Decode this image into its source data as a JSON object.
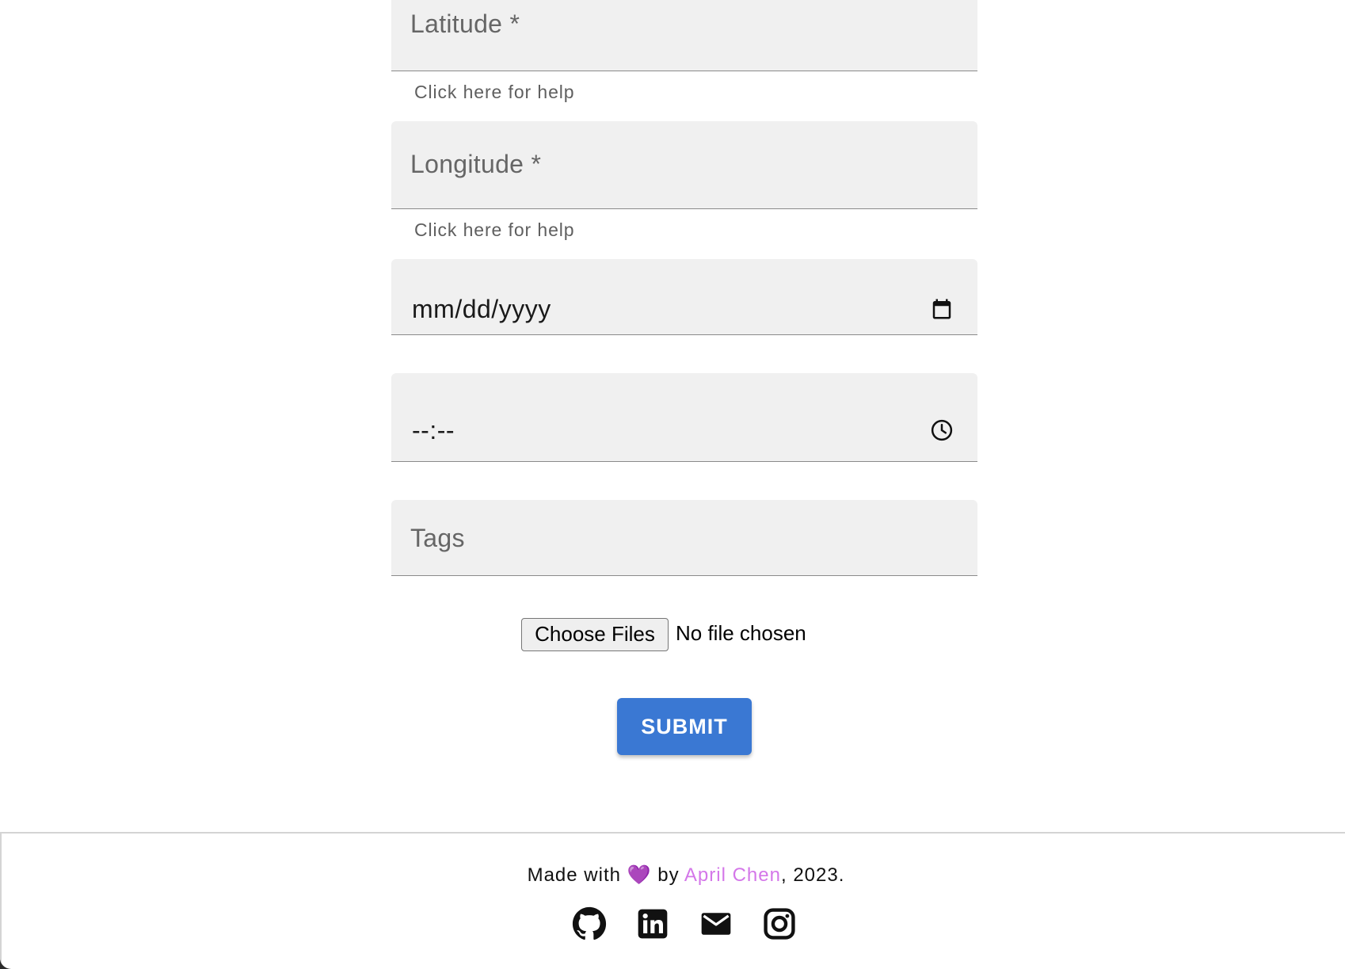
{
  "form": {
    "latitude": {
      "label": "Latitude *",
      "helper": "Click here for help"
    },
    "longitude": {
      "label": "Longitude *",
      "helper": "Click here for help"
    },
    "date": {
      "value": "mm/dd/yyyy",
      "icon": "calendar-icon"
    },
    "time": {
      "value": "--:--",
      "icon": "clock-icon"
    },
    "tags": {
      "label": "Tags"
    },
    "file": {
      "button_label": "Choose Files",
      "status": "No file chosen"
    },
    "submit_label": "SUBMIT"
  },
  "footer": {
    "credit_prefix": "Made with",
    "heart": "💜",
    "credit_by": "by",
    "author": "April Chen",
    "credit_suffix": ", 2023.",
    "socials": [
      {
        "icon": "github-icon"
      },
      {
        "icon": "linkedin-icon"
      },
      {
        "icon": "email-icon"
      },
      {
        "icon": "instagram-icon"
      }
    ]
  },
  "colors": {
    "field_bg": "#f0f0f0",
    "submit_bg": "#3a78d3",
    "author_link": "#d477e9"
  }
}
